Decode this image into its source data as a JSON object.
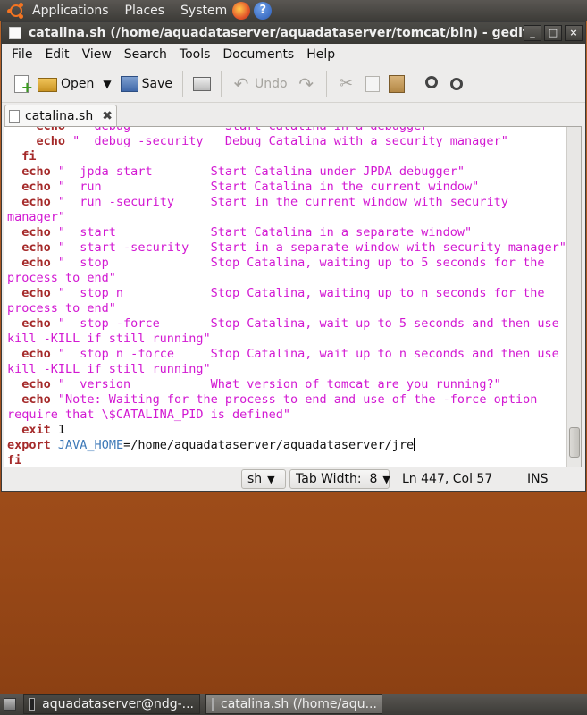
{
  "top_panel": {
    "menus": [
      "Applications",
      "Places",
      "System"
    ],
    "icons": [
      "ubuntu-logo",
      "firefox-icon",
      "help-icon"
    ]
  },
  "window": {
    "title": "catalina.sh (/home/aquadataserver/aquadataserver/tomcat/bin) - gedit",
    "controls": [
      "_",
      "□",
      "×"
    ]
  },
  "menubar": [
    "File",
    "Edit",
    "View",
    "Search",
    "Tools",
    "Documents",
    "Help"
  ],
  "toolbar": {
    "open_label": "Open",
    "save_label": "Save",
    "undo_label": "Undo"
  },
  "tab": {
    "label": "catalina.sh",
    "close": "✖"
  },
  "editor": {
    "lines": [
      [
        {
          "t": "    "
        },
        {
          "t": "echo",
          "c": "k"
        },
        {
          "t": " \"  debug             Start Catalina in a debugger\"",
          "c": "s"
        }
      ],
      [
        {
          "t": "    "
        },
        {
          "t": "echo",
          "c": "k"
        },
        {
          "t": " \"  debug -security   Debug Catalina with a security manager\"",
          "c": "s"
        }
      ],
      [
        {
          "t": "  "
        },
        {
          "t": "fi",
          "c": "k"
        }
      ],
      [
        {
          "t": "  "
        },
        {
          "t": "echo",
          "c": "k"
        },
        {
          "t": " \"  jpda start        Start Catalina under JPDA debugger\"",
          "c": "s"
        }
      ],
      [
        {
          "t": "  "
        },
        {
          "t": "echo",
          "c": "k"
        },
        {
          "t": " \"  run               Start Catalina in the current window\"",
          "c": "s"
        }
      ],
      [
        {
          "t": "  "
        },
        {
          "t": "echo",
          "c": "k"
        },
        {
          "t": " \"  run -security     Start in the current window with security",
          "c": "s"
        }
      ],
      [
        {
          "t": "manager\"",
          "c": "s"
        }
      ],
      [
        {
          "t": "  "
        },
        {
          "t": "echo",
          "c": "k"
        },
        {
          "t": " \"  start             Start Catalina in a separate window\"",
          "c": "s"
        }
      ],
      [
        {
          "t": "  "
        },
        {
          "t": "echo",
          "c": "k"
        },
        {
          "t": " \"  start -security   Start in a separate window with security manager\"",
          "c": "s"
        }
      ],
      [
        {
          "t": "  "
        },
        {
          "t": "echo",
          "c": "k"
        },
        {
          "t": " \"  stop              Stop Catalina, waiting up to 5 seconds for the",
          "c": "s"
        }
      ],
      [
        {
          "t": "process to end\"",
          "c": "s"
        }
      ],
      [
        {
          "t": "  "
        },
        {
          "t": "echo",
          "c": "k"
        },
        {
          "t": " \"  stop n            Stop Catalina, waiting up to n seconds for the",
          "c": "s"
        }
      ],
      [
        {
          "t": "process to end\"",
          "c": "s"
        }
      ],
      [
        {
          "t": "  "
        },
        {
          "t": "echo",
          "c": "k"
        },
        {
          "t": " \"  stop -force       Stop Catalina, wait up to 5 seconds and then use",
          "c": "s"
        }
      ],
      [
        {
          "t": "kill -KILL if still running\"",
          "c": "s"
        }
      ],
      [
        {
          "t": "  "
        },
        {
          "t": "echo",
          "c": "k"
        },
        {
          "t": " \"  stop n -force     Stop Catalina, wait up to n seconds and then use",
          "c": "s"
        }
      ],
      [
        {
          "t": "kill -KILL if still running\"",
          "c": "s"
        }
      ],
      [
        {
          "t": "  "
        },
        {
          "t": "echo",
          "c": "k"
        },
        {
          "t": " \"  version           What version of tomcat are you running?\"",
          "c": "s"
        }
      ],
      [
        {
          "t": "  "
        },
        {
          "t": "echo",
          "c": "k"
        },
        {
          "t": " \"Note: Waiting for the process to end and use of the -force option",
          "c": "s"
        }
      ],
      [
        {
          "t": "require that \\$CATALINA_PID is defined\"",
          "c": "s"
        }
      ],
      [
        {
          "t": "  "
        },
        {
          "t": "exit",
          "c": "k"
        },
        {
          "t": " 1"
        }
      ],
      [
        {
          "t": "export",
          "c": "k"
        },
        {
          "t": " "
        },
        {
          "t": "JAVA_HOME",
          "c": "v"
        },
        {
          "t": "=/home/aquadataserver/aquadataserver/jre"
        },
        {
          "t": "",
          "c": "cursor"
        }
      ],
      [
        {
          "t": "fi",
          "c": "k"
        }
      ]
    ]
  },
  "statusbar": {
    "language": "sh",
    "tab_width": "Tab Width:  8",
    "position": "Ln 447, Col 57",
    "mode": "INS"
  },
  "bottom_panel": {
    "tasks": [
      "aquadataserver@ndg-...",
      "catalina.sh (/home/aqu..."
    ]
  }
}
